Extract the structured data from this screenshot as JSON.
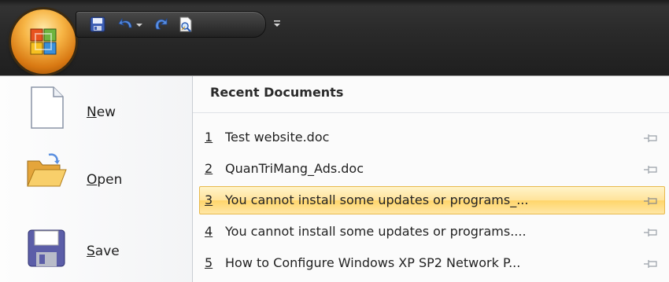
{
  "quick_access": {
    "buttons": [
      {
        "icon": "save-icon"
      },
      {
        "icon": "undo-icon"
      },
      {
        "icon": "undo-dropdown-icon"
      },
      {
        "icon": "redo-icon"
      },
      {
        "icon": "print-preview-icon"
      },
      {
        "icon": "customize-qat-icon"
      }
    ]
  },
  "office_button": {
    "icon": "office-logo-icon"
  },
  "commands": [
    {
      "mnemonic": "N",
      "rest": "ew",
      "icon": "new-document-icon"
    },
    {
      "mnemonic": "O",
      "rest": "pen",
      "icon": "open-folder-icon"
    },
    {
      "mnemonic": "S",
      "rest": "ave",
      "icon": "save-floppy-icon"
    }
  ],
  "recent": {
    "title": "Recent Documents",
    "items": [
      {
        "num": "1",
        "name": "Test website.doc",
        "highlighted": false
      },
      {
        "num": "2",
        "name": "QuanTriMang_Ads.doc",
        "highlighted": false
      },
      {
        "num": "3",
        "name": "You cannot install some updates or programs_...",
        "highlighted": true
      },
      {
        "num": "4",
        "name": "You cannot install some updates or programs....",
        "highlighted": false
      },
      {
        "num": "5",
        "name": "How to Configure Windows XP SP2 Network P...",
        "highlighted": false
      }
    ]
  },
  "colors": {
    "highlight": "#ffe39a",
    "highlight_border": "#e8b94d",
    "orb": "#f7b545"
  }
}
